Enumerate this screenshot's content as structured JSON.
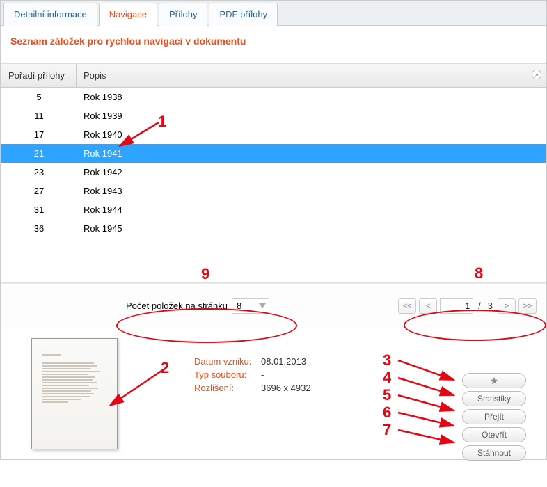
{
  "tabs": {
    "detail": "Detailní informace",
    "nav": "Navigace",
    "attach": "Přílohy",
    "pdf": "PDF přílohy"
  },
  "heading": "Seznam záložek pro rychlou navigaci v dokumentu",
  "table": {
    "col_poradi": "Pořadí přílohy",
    "col_popis": "Popis",
    "rows": [
      {
        "poradi": "5",
        "popis": "Rok 1938"
      },
      {
        "poradi": "11",
        "popis": "Rok 1939"
      },
      {
        "poradi": "17",
        "popis": "Rok 1940"
      },
      {
        "poradi": "21",
        "popis": "Rok 1941"
      },
      {
        "poradi": "23",
        "popis": "Rok 1942"
      },
      {
        "poradi": "27",
        "popis": "Rok 1943"
      },
      {
        "poradi": "31",
        "popis": "Rok 1944"
      },
      {
        "poradi": "36",
        "popis": "Rok 1945"
      }
    ],
    "selected_index": 3
  },
  "pager": {
    "page_size_label": "Počet položek na stránku",
    "page_size_value": "8",
    "first": "<<",
    "prev": "<",
    "current": "1",
    "sep": "/",
    "total": "3",
    "next": ">",
    "last": ">>"
  },
  "detail": {
    "datum_label": "Datum vzniku:",
    "datum_val": "08.01.2013",
    "typ_label": "Typ souboru:",
    "typ_val": "-",
    "rozliseni_label": "Rozlišení:",
    "rozliseni_val": "3696 x 4932"
  },
  "buttons": {
    "star": "★",
    "stat": "Statistiky",
    "prejit": "Přejít",
    "otevrit": "Otevřít",
    "stahnout": "Stáhnout"
  },
  "annotations": {
    "n1": "1",
    "n2": "2",
    "n3": "3",
    "n4": "4",
    "n5": "5",
    "n6": "6",
    "n7": "7",
    "n8": "8",
    "n9": "9"
  }
}
